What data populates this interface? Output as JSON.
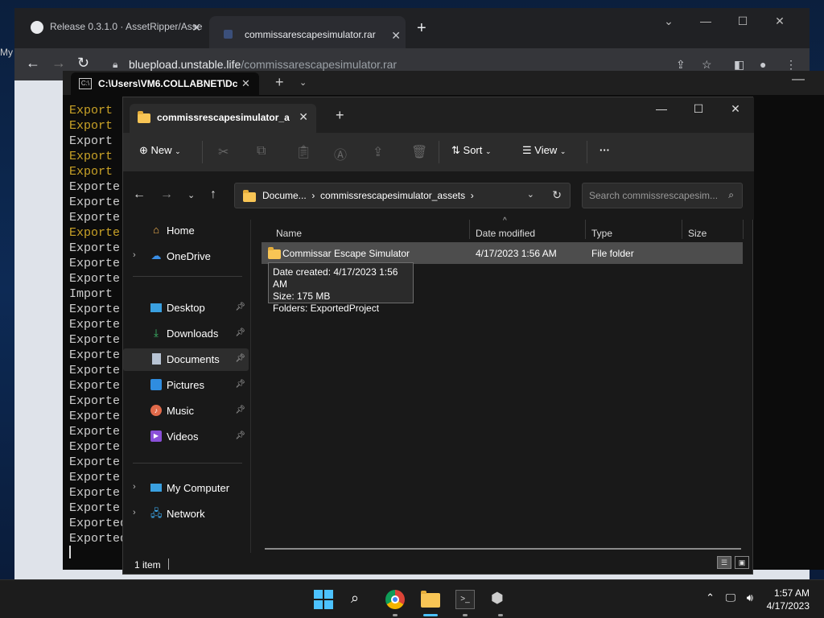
{
  "browser": {
    "tabs": [
      {
        "title": "Release 0.3.1.0 · AssetRipper/Asse"
      },
      {
        "title": "commissarescapesimulator.rar"
      }
    ],
    "new_tab": "+",
    "url_domain": "blueplоad.unstable.life",
    "url_path": "/commissarescapesimulator.rar",
    "side_text": "My"
  },
  "terminal": {
    "tab_title": "C:\\Users\\VM6.COLLABNET\\Dc",
    "lines": [
      {
        "text": "Export",
        "color": "yellow"
      },
      {
        "text": "Export",
        "color": "yellow"
      },
      {
        "text": "Export",
        "color": "white"
      },
      {
        "text": "Export",
        "color": "yellow"
      },
      {
        "text": "Export",
        "color": "yellow"
      },
      {
        "text": "Exporte",
        "color": "white"
      },
      {
        "text": "Exporte",
        "color": "white"
      },
      {
        "text": "Exporte",
        "color": "white"
      },
      {
        "text": "Exporte",
        "color": "yellow"
      },
      {
        "text": "Exporte",
        "color": "white"
      },
      {
        "text": "Exporte",
        "color": "white"
      },
      {
        "text": "Exporte",
        "color": "white"
      },
      {
        "text": "Import",
        "color": "white"
      },
      {
        "text": "Exporte",
        "color": "white"
      },
      {
        "text": "Exporte",
        "color": "white"
      },
      {
        "text": "Exporte",
        "color": "white"
      },
      {
        "text": "Exporte",
        "color": "white"
      },
      {
        "text": "Exporte",
        "color": "white"
      },
      {
        "text": "Exporte",
        "color": "white"
      },
      {
        "text": "Exporte",
        "color": "white"
      },
      {
        "text": "Exporte",
        "color": "white"
      },
      {
        "text": "Exporte",
        "color": "white"
      },
      {
        "text": "Exporte",
        "color": "white"
      },
      {
        "text": "Exporte",
        "color": "white"
      },
      {
        "text": "Exporte",
        "color": "white"
      },
      {
        "text": "Exporte",
        "color": "white"
      },
      {
        "text": "Exporte",
        "color": "white"
      },
      {
        "text": "Exported",
        "color": "white"
      },
      {
        "text": "Exported",
        "color": "white"
      }
    ]
  },
  "explorer": {
    "tab_title": "commissrescapesimulator_assets",
    "toolbar": {
      "new": "New",
      "sort": "Sort",
      "view": "View",
      "more": "···"
    },
    "breadcrumb": {
      "part1": "Docume...",
      "sep": "›",
      "part2": "commissrescapesimulator_assets"
    },
    "search_placeholder": "Search commissrescapesim...",
    "nav": {
      "home": "Home",
      "onedrive": "OneDrive",
      "desktop": "Desktop",
      "downloads": "Downloads",
      "documents": "Documents",
      "pictures": "Pictures",
      "music": "Music",
      "videos": "Videos",
      "mycomputer": "My Computer",
      "network": "Network"
    },
    "columns": {
      "name": "Name",
      "date": "Date modified",
      "type": "Type",
      "size": "Size"
    },
    "rows": [
      {
        "name": "Commissar Escape Simulator",
        "date": "4/17/2023 1:56 AM",
        "type": "File folder",
        "size": ""
      }
    ],
    "tooltip": {
      "created": "Date created: 4/17/2023 1:56 AM",
      "size": "Size: 175 MB",
      "folders": "Folders: ExportedProject"
    },
    "status": "1 item"
  },
  "taskbar": {
    "time": "1:57 AM",
    "date": "4/17/2023"
  },
  "colors": {
    "accent": "#4cc2ff",
    "folder": "#f8c555",
    "terminal_yellow": "#c9a227"
  }
}
